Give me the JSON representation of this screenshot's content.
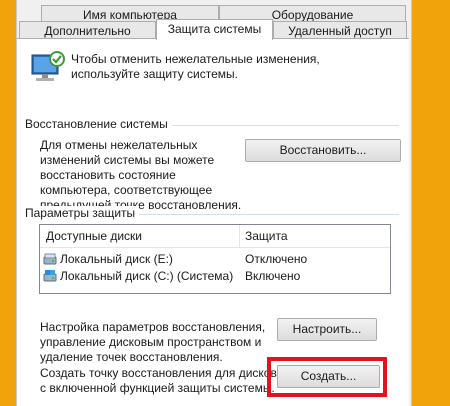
{
  "tabs": {
    "computer_name": "Имя компьютера",
    "hardware": "Оборудование",
    "advanced": "Дополнительно",
    "system_protection": "Защита системы",
    "remote": "Удаленный доступ"
  },
  "intro_text": "Чтобы отменить нежелательные изменения, используйте защиту системы.",
  "restore": {
    "group_title": "Восстановление системы",
    "description": "Для отмены нежелательных изменений системы вы можете восстановить состояние компьютера, соответствующее предыдущей точке восстановления.",
    "button_label": "Восстановить..."
  },
  "protection": {
    "group_title": "Параметры защиты",
    "columns": [
      "Доступные диски",
      "Защита"
    ],
    "rows": [
      {
        "name": "Локальный диск (E:)",
        "state": "Отключено",
        "icon": "drive-icon"
      },
      {
        "name": "Локальный диск (C:) (Система)",
        "state": "Включено",
        "icon": "system-drive-icon"
      }
    ],
    "configure_text": "Настройка параметров восстановления, управление дисковым пространством и удаление точек восстановления.",
    "configure_button": "Настроить...",
    "create_text": "Создать точку восстановления для дисков с включенной функцией защиты системы.",
    "create_button": "Создать..."
  },
  "colors": {
    "desktop": "#f0a30a",
    "highlight": "#e5121b"
  }
}
